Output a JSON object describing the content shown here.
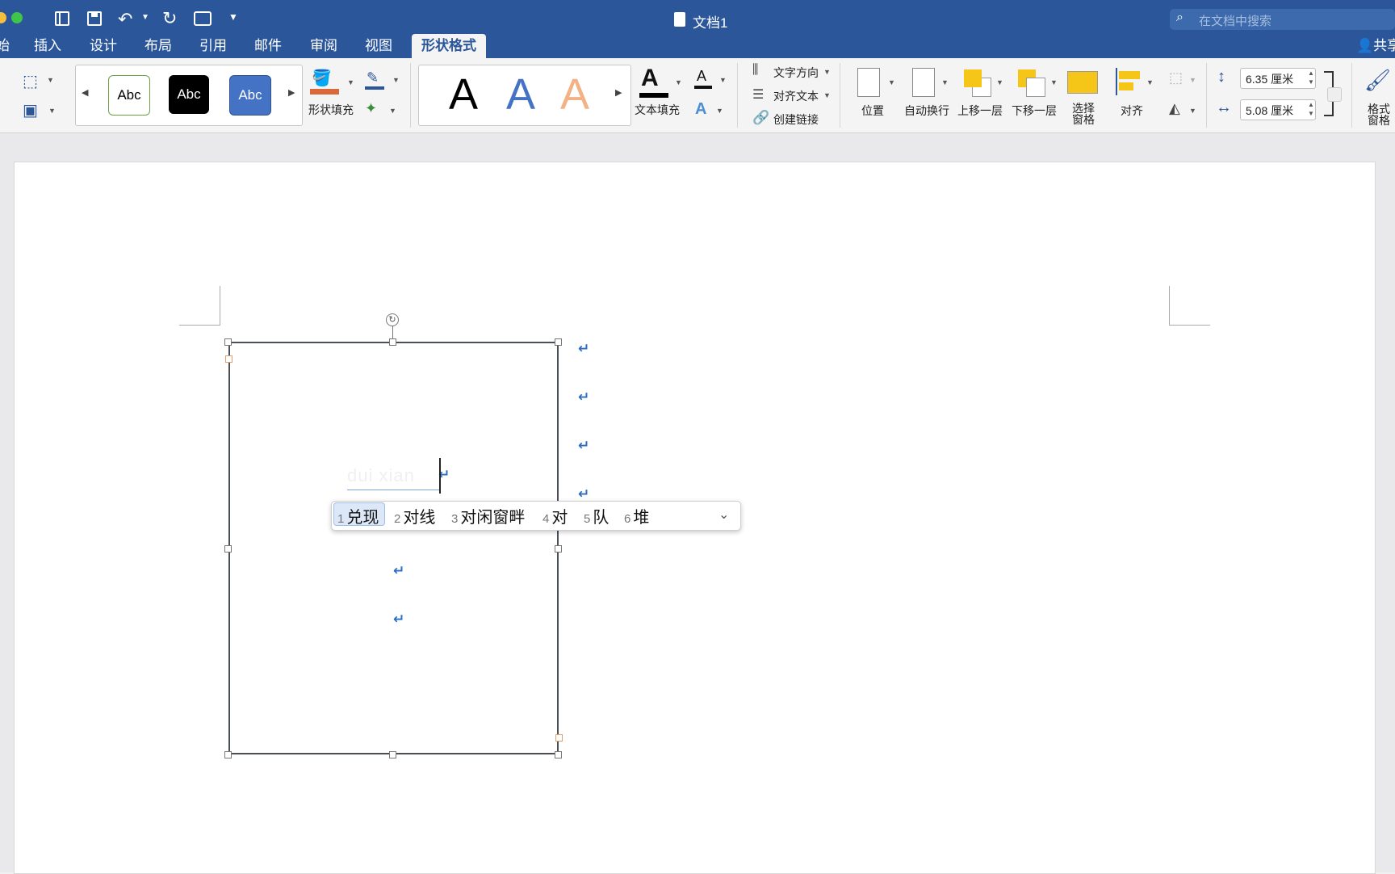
{
  "window": {
    "title": "文档1",
    "search_placeholder": "在文档中搜索",
    "share_label": "共享"
  },
  "tabs": [
    {
      "label": "始"
    },
    {
      "label": "插入"
    },
    {
      "label": "设计"
    },
    {
      "label": "布局"
    },
    {
      "label": "引用"
    },
    {
      "label": "邮件"
    },
    {
      "label": "审阅"
    },
    {
      "label": "视图"
    },
    {
      "label": "形状格式",
      "active": true
    }
  ],
  "ribbon": {
    "shape_styles": [
      "Abc",
      "Abc",
      "Abc"
    ],
    "shape_fill_label": "形状填充",
    "wordart_styles": [
      "A",
      "A",
      "A"
    ],
    "text_fill_label": "文本填充",
    "text_direction_label": "文字方向",
    "align_text_label": "对齐文本",
    "create_link_label": "创建链接",
    "position_label": "位置",
    "wrap_text_label": "自动换行",
    "bring_forward_label": "上移一层",
    "send_backward_label": "下移一层",
    "selection_pane_label": "选择\n窗格",
    "align_label": "对齐",
    "height_value": "6.35 厘米",
    "width_value": "5.08 厘米",
    "format_pane_label": "格式\n窗格"
  },
  "ime": {
    "composition": "dui xian",
    "candidates": [
      {
        "num": "1",
        "text": "兑现"
      },
      {
        "num": "2",
        "text": "对线"
      },
      {
        "num": "3",
        "text": "对闲窗畔"
      },
      {
        "num": "4",
        "text": "对"
      },
      {
        "num": "5",
        "text": "队"
      },
      {
        "num": "6",
        "text": "堆"
      }
    ]
  },
  "colors": {
    "accent": "#2b579a",
    "fill_orange": "#d9683a",
    "yellow": "#f5c518"
  }
}
